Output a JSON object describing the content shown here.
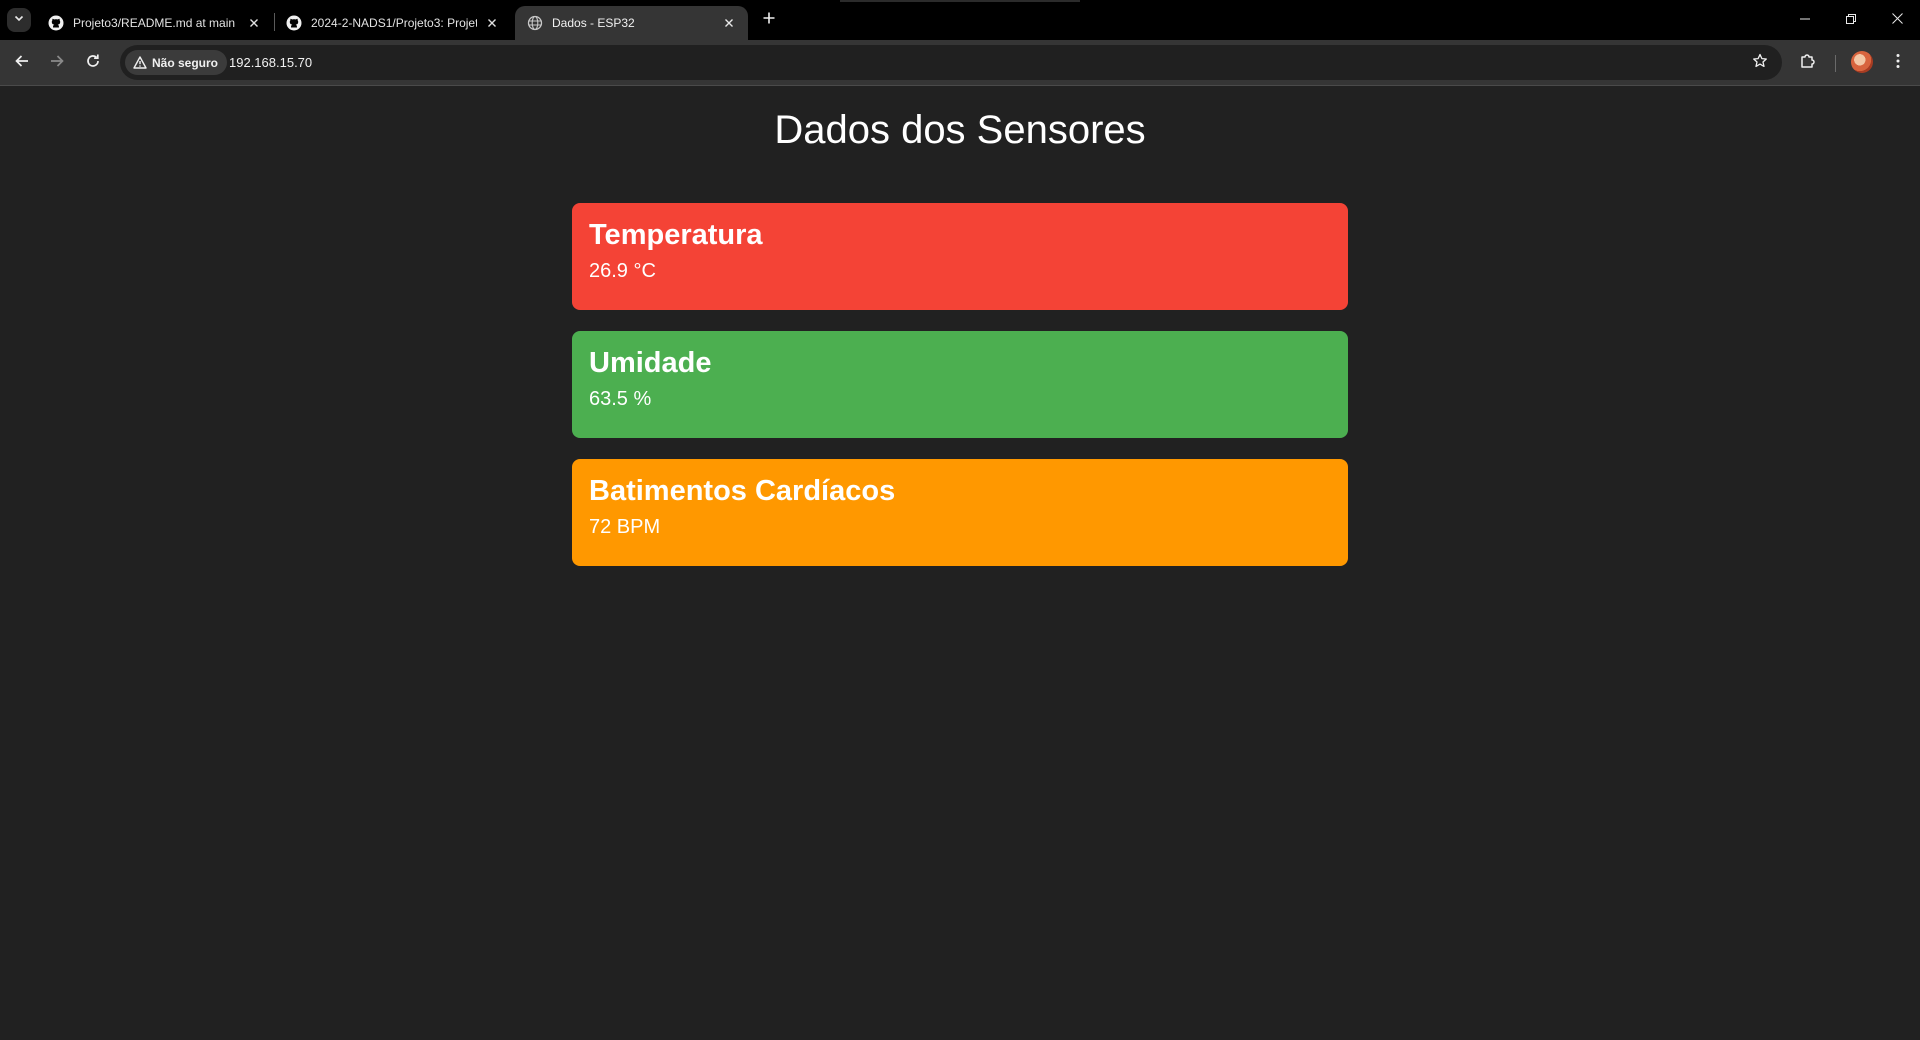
{
  "browser": {
    "tabs": [
      {
        "title": "Projeto3/README.md at main ·",
        "icon": "github-icon",
        "active": false
      },
      {
        "title": "2024-2-NADS1/Projeto3: Projet",
        "icon": "github-icon",
        "active": false
      },
      {
        "title": "Dados - ESP32",
        "icon": "globe-icon",
        "active": true
      }
    ],
    "address": {
      "security_label": "Não seguro",
      "url": "192.168.15.70"
    }
  },
  "page": {
    "title": "Dados dos Sensores",
    "cards": [
      {
        "label": "Temperatura",
        "value": "26.9 °C",
        "color": "#f44336"
      },
      {
        "label": "Umidade",
        "value": "63.5 %",
        "color": "#4caf50"
      },
      {
        "label": "Batimentos Cardíacos",
        "value": "72 BPM",
        "color": "#ff9800"
      }
    ]
  }
}
